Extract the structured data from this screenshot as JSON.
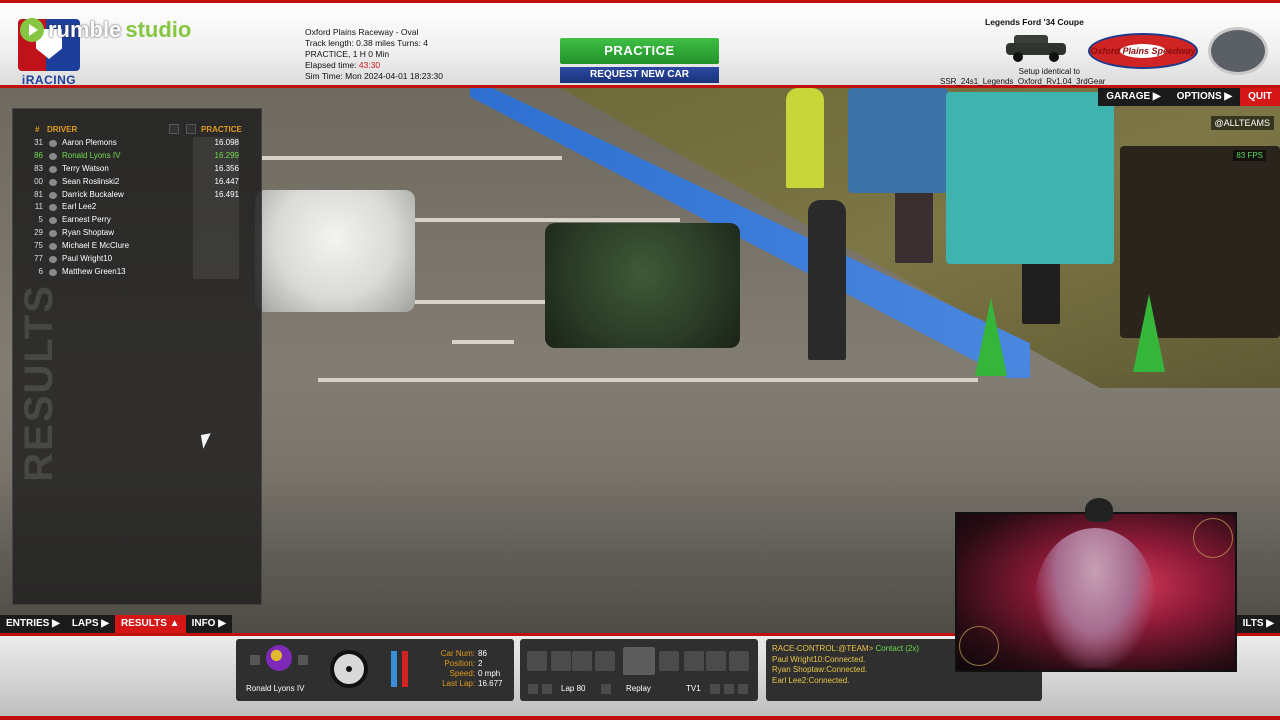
{
  "branding": {
    "rumble_prefix": "rumble",
    "rumble_suffix": "studio",
    "iracing_label": "iRACING",
    "track_logo_text": "Oxford Plains Speedway"
  },
  "session": {
    "track_line": "Oxford Plains Raceway - Oval",
    "length_line": "Track length: 0.38 miles Turns: 4",
    "session_line": "PRACTICE, 1 H 0 Min",
    "elapsed_label": "Elapsed time: ",
    "elapsed_value": "43:30",
    "sim_time_line": "Sim Time: Mon 2024-04-01 18:23:30"
  },
  "buttons": {
    "practice": "PRACTICE",
    "request_new_car": "REQUEST NEW CAR"
  },
  "car": {
    "name": "Legends Ford '34 Coupe",
    "setup_line1": "Setup identical to",
    "setup_line2": "SSR_24s1_Legends_Oxford_Rv1.04_3rdGear"
  },
  "top_nav": {
    "garage": "GARAGE ▶",
    "options": "OPTIONS ▶",
    "quit": "QUIT"
  },
  "overlay": {
    "allteams": "@ALLTEAMS",
    "fps": "83 FPS"
  },
  "results": {
    "watermark": "RESULTS",
    "header": {
      "num": "#",
      "driver": "DRIVER",
      "practice": "PRACTICE"
    },
    "rows": [
      {
        "num": "31",
        "name": "Aaron Plemons",
        "time": "16.098"
      },
      {
        "num": "86",
        "name": "Ronald Lyons IV",
        "time": "16.299",
        "selected": true
      },
      {
        "num": "83",
        "name": "Terry Watson",
        "time": "16.356"
      },
      {
        "num": "00",
        "name": "Sean Roslinski2",
        "time": "16.447"
      },
      {
        "num": "81",
        "name": "Darrick Buckalew",
        "time": "16.491"
      },
      {
        "num": "11",
        "name": "Earl Lee2",
        "time": ""
      },
      {
        "num": "5",
        "name": "Earnest Perry",
        "time": ""
      },
      {
        "num": "29",
        "name": "Ryan Shoptaw",
        "time": ""
      },
      {
        "num": "75",
        "name": "Michael E McClure",
        "time": ""
      },
      {
        "num": "77",
        "name": "Paul Wright10",
        "time": ""
      },
      {
        "num": "6",
        "name": "Matthew Green13",
        "time": ""
      }
    ]
  },
  "bottom_tabs": {
    "entries": "ENTRIES ▶",
    "laps": "LAPS ▶",
    "results": "RESULTS ▲",
    "info": "INFO ▶",
    "right_partial": "ILTS ▶"
  },
  "dashboard": {
    "driver_name": "Ronald Lyons IV",
    "stats": [
      {
        "label": "Car Num:",
        "value": "86"
      },
      {
        "label": "Position:",
        "value": "2"
      },
      {
        "label": "Speed:",
        "value": "0 mph"
      },
      {
        "label": "Last Lap:",
        "value": "16.677"
      }
    ],
    "replay": {
      "lap": "Lap 80",
      "mode": "Replay",
      "camera": "TV1"
    }
  },
  "chat": {
    "lines": [
      {
        "prefix": "RACE-CONTROL:@TEAM> ",
        "emphasis": "Contact (2x)"
      },
      {
        "prefix": "Paul Wright10:Connected.",
        "emphasis": ""
      },
      {
        "prefix": "Ryan Shoptaw:Connected.",
        "emphasis": ""
      },
      {
        "prefix": "Earl Lee2:Connected.",
        "emphasis": ""
      }
    ]
  },
  "colors": {
    "accent_red": "#c01010",
    "practice_green": "#21922a",
    "request_blue": "#1b327a",
    "label_orange": "#e09a1c",
    "selected_green": "#6fdc4f"
  }
}
